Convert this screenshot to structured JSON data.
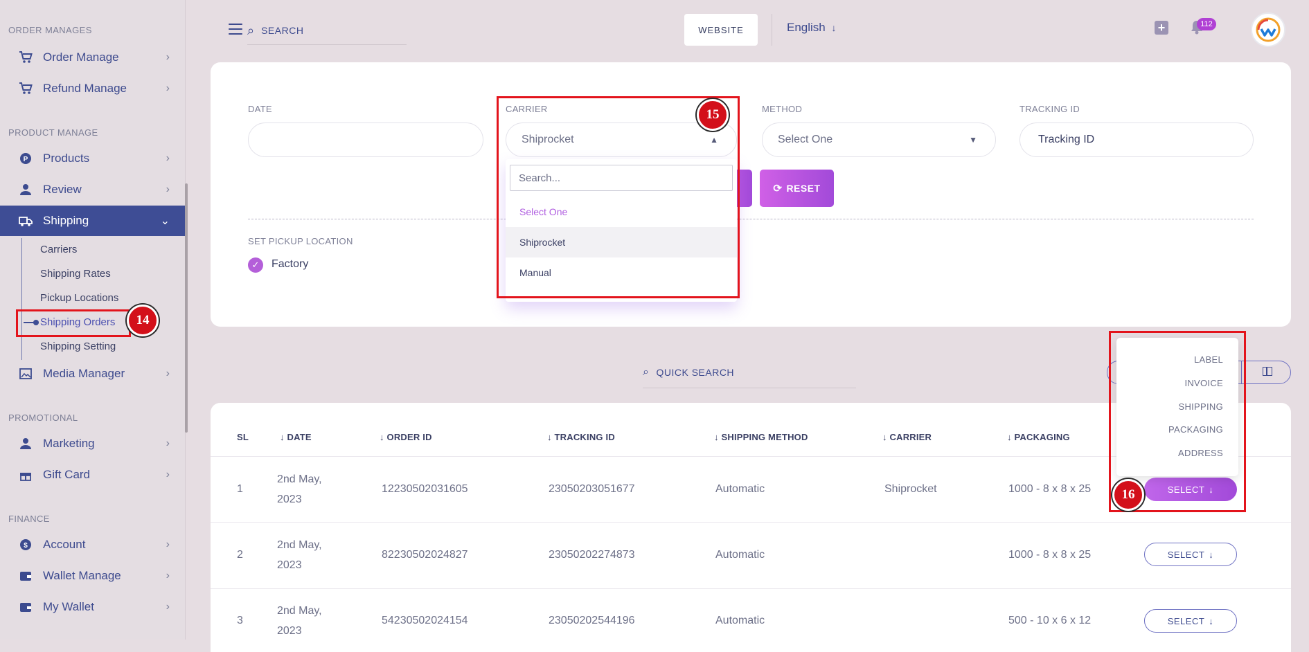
{
  "sidebar": {
    "sections": {
      "order": "ORDER MANAGES",
      "product": "PRODUCT MANAGE",
      "promotional": "PROMOTIONAL",
      "finance": "FINANCE"
    },
    "items": {
      "order_manage": "Order Manage",
      "refund_manage": "Refund Manage",
      "products": "Products",
      "review": "Review",
      "shipping": "Shipping",
      "media_manager": "Media Manager",
      "marketing": "Marketing",
      "gift_card": "Gift Card",
      "account": "Account",
      "wallet_manage": "Wallet Manage",
      "my_wallet": "My Wallet"
    },
    "shipping_sub": [
      "Carriers",
      "Shipping Rates",
      "Pickup Locations",
      "Shipping Orders",
      "Shipping Setting"
    ]
  },
  "header": {
    "search_label": "SEARCH",
    "website_button": "WEBSITE",
    "language": "English",
    "notification_count": "112"
  },
  "filters": {
    "date_label": "DATE",
    "date_value": "",
    "carrier_label": "CARRIER",
    "carrier_value": "Shiprocket",
    "method_label": "METHOD",
    "method_value": "Select One",
    "tracking_label": "TRACKING ID",
    "tracking_placeholder": "Tracking ID",
    "reset_button": "RESET",
    "pickup_label": "SET PICKUP LOCATION",
    "pickup_option": "Factory"
  },
  "carrier_dropdown": {
    "search_placeholder": "Search...",
    "options": [
      "Select One",
      "Shiprocket",
      "Manual"
    ]
  },
  "annotations": {
    "badge_14": "14",
    "badge_15": "15",
    "badge_16": "16"
  },
  "table": {
    "quick_search": "QUICK SEARCH",
    "columns": [
      "SL",
      "DATE",
      "ORDER ID",
      "TRACKING ID",
      "SHIPPING METHOD",
      "CARRIER",
      "PACKAGING"
    ],
    "rows": [
      {
        "sl": "1",
        "date_line1": "2nd May,",
        "date_line2": "2023",
        "order_id": "12230502031605",
        "tracking_id": "23050203051677",
        "method": "Automatic",
        "carrier": "Shiprocket",
        "packaging": "1000 - 8 x 8 x 25",
        "action": "SELECT"
      },
      {
        "sl": "2",
        "date_line1": "2nd May,",
        "date_line2": "2023",
        "order_id": "82230502024827",
        "tracking_id": "23050202274873",
        "method": "Automatic",
        "carrier": "",
        "packaging": "1000 - 8 x 8 x 25",
        "action": "SELECT"
      },
      {
        "sl": "3",
        "date_line1": "2nd May,",
        "date_line2": "2023",
        "order_id": "54230502024154",
        "tracking_id": "23050202544196",
        "method": "Automatic",
        "carrier": "",
        "packaging": "500 - 10 x 6 x 12",
        "action": "SELECT"
      }
    ]
  },
  "select_menu": {
    "items": [
      "LABEL",
      "INVOICE",
      "SHIPPING",
      "PACKAGING",
      "ADDRESS"
    ]
  },
  "colors": {
    "sidebar_active": "#3e4d95",
    "accent_gradient_start": "#d060e6",
    "accent_gradient_end": "#a24ad9",
    "annotation_red": "#e3141c"
  }
}
